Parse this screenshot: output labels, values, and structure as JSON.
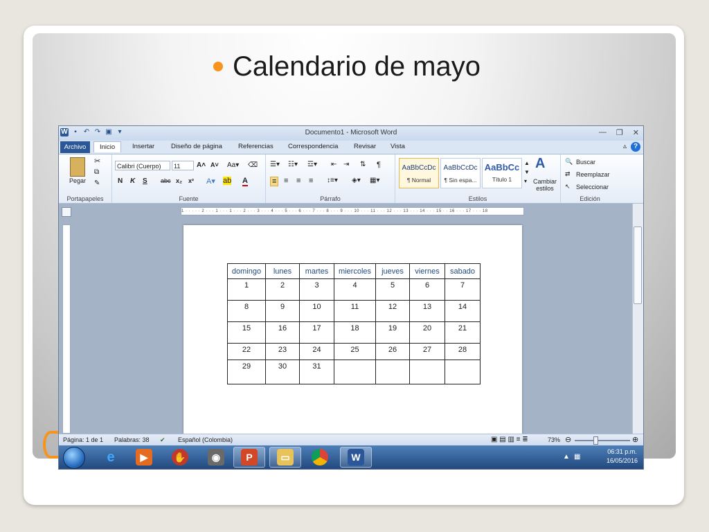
{
  "slide": {
    "title": "Calendario de mayo"
  },
  "word": {
    "title": "Documento1 - Microsoft Word",
    "tabs": [
      "Archivo",
      "Inicio",
      "Insertar",
      "Diseño de página",
      "Referencias",
      "Correspondencia",
      "Revisar",
      "Vista"
    ],
    "active_tab": "Inicio",
    "ribbon": {
      "portapapeles": {
        "label": "Portapapeles",
        "paste": "Pegar"
      },
      "fuente": {
        "label": "Fuente",
        "font": "Calibri (Cuerpo)",
        "size": "11"
      },
      "parrafo": {
        "label": "Párrafo"
      },
      "estilos": {
        "label": "Estilos",
        "items": [
          {
            "sample": "AaBbCcDc",
            "name": "¶ Normal"
          },
          {
            "sample": "AaBbCcDc",
            "name": "¶ Sin espa..."
          },
          {
            "sample": "AaBbCc",
            "name": "Título 1"
          }
        ],
        "change": "Cambiar estilos"
      },
      "edicion": {
        "label": "Edición",
        "find": "Buscar",
        "replace": "Reemplazar",
        "select": "Seleccionar"
      }
    },
    "ruler_text": "1 · · · · · 2 · · · 1 · · · 1 · · · 2 · · · 3 · · · 4 · · · 5 · · · 6 · · · 7 · · · 8 · · · 9 · · · 10 · · · 11 · · · 12 · · · 13 · · · 14 · · · 15 · · 16 · · · 17 · · · 18",
    "calendar": {
      "headers": [
        "domingo",
        "lunes",
        "martes",
        "miercoles",
        "jueves",
        "viernes",
        "sabado"
      ],
      "rows": [
        [
          "1",
          "2",
          "3",
          "4",
          "5",
          "6",
          "7"
        ],
        [
          "8",
          "9",
          "10",
          "11",
          "12",
          "13",
          "14"
        ],
        [
          "15",
          "16",
          "17",
          "18",
          "19",
          "20",
          "21"
        ],
        [
          "22",
          "23",
          "24",
          "25",
          "26",
          "27",
          "28"
        ],
        [
          "29",
          "30",
          "31",
          "",
          "",
          "",
          ""
        ]
      ]
    },
    "status": {
      "page": "Página: 1 de 1",
      "words": "Palabras: 38",
      "language": "Español (Colombia)",
      "zoom": "73%"
    }
  },
  "taskbar": {
    "time": "06:31 p.m.",
    "date": "16/05/2016"
  }
}
